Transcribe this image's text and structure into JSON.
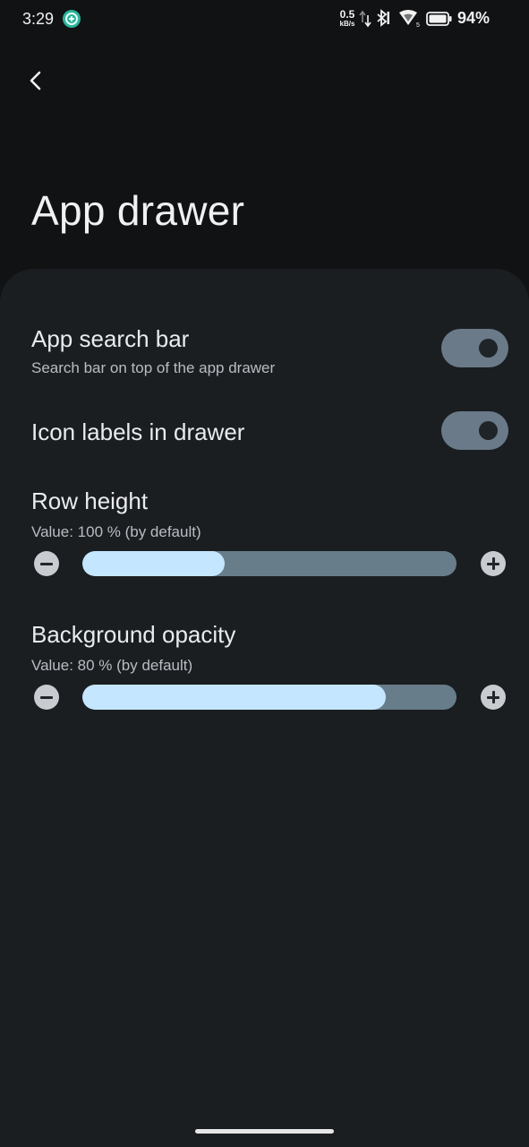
{
  "status_bar": {
    "time": "3:29",
    "net_speed_value": "0.5",
    "net_speed_unit": "kB/s",
    "battery_percent": "94%",
    "icons": [
      "app-notification-icon",
      "data-arrows-icon",
      "bluetooth-icon",
      "wifi-icon",
      "battery-icon"
    ]
  },
  "header": {
    "back_icon": "chevron-left-icon",
    "title": "App drawer"
  },
  "settings": {
    "search_bar": {
      "title": "App search bar",
      "subtitle": "Search bar on top of the app drawer",
      "enabled": true
    },
    "icon_labels": {
      "title": "Icon labels in drawer",
      "enabled": true
    },
    "row_height": {
      "title": "Row height",
      "value_text": "Value: 100 % (by default)",
      "fill_fraction": 0.38
    },
    "bg_opacity": {
      "title": "Background opacity",
      "value_text": "Value: 80 % (by default)",
      "fill_fraction": 0.81
    }
  },
  "colors": {
    "background": "#111214",
    "sheet": "#1b1e21",
    "toggle_track": "#6a7a88",
    "slider_fill": "#c4e6ff",
    "slider_track": "#677d8a"
  }
}
